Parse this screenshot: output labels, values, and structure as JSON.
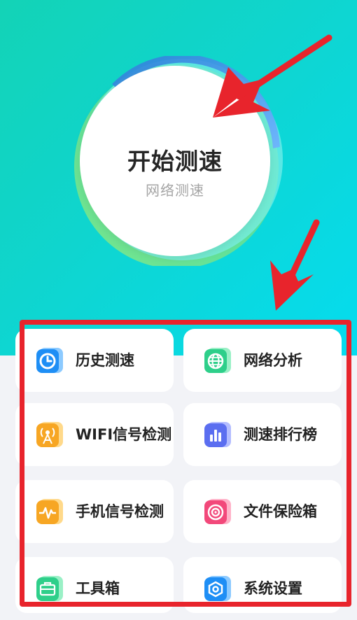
{
  "speed_test": {
    "title": "开始测速",
    "subtitle": "网络测速"
  },
  "menu": {
    "items": [
      {
        "label": "历史测速",
        "icon": "clock-icon",
        "color": "#1e8ef5"
      },
      {
        "label": "网络分析",
        "icon": "globe-icon",
        "color": "#2ecf8a"
      },
      {
        "label": "WIFI信号检测",
        "icon": "signal-tower-icon",
        "color": "#f7a623"
      },
      {
        "label": "测速排行榜",
        "icon": "bar-chart-icon",
        "color": "#5b6ef0"
      },
      {
        "label": "手机信号检测",
        "icon": "pulse-icon",
        "color": "#f7a623"
      },
      {
        "label": "文件保险箱",
        "icon": "vault-icon",
        "color": "#f2487a"
      },
      {
        "label": "工具箱",
        "icon": "toolbox-icon",
        "color": "#2ecf8a"
      },
      {
        "label": "系统设置",
        "icon": "settings-icon",
        "color": "#1e8ef5"
      }
    ]
  },
  "colors": {
    "hero_start": "#13d3b6",
    "hero_end": "#05dcef",
    "annotation": "#e8242c"
  }
}
